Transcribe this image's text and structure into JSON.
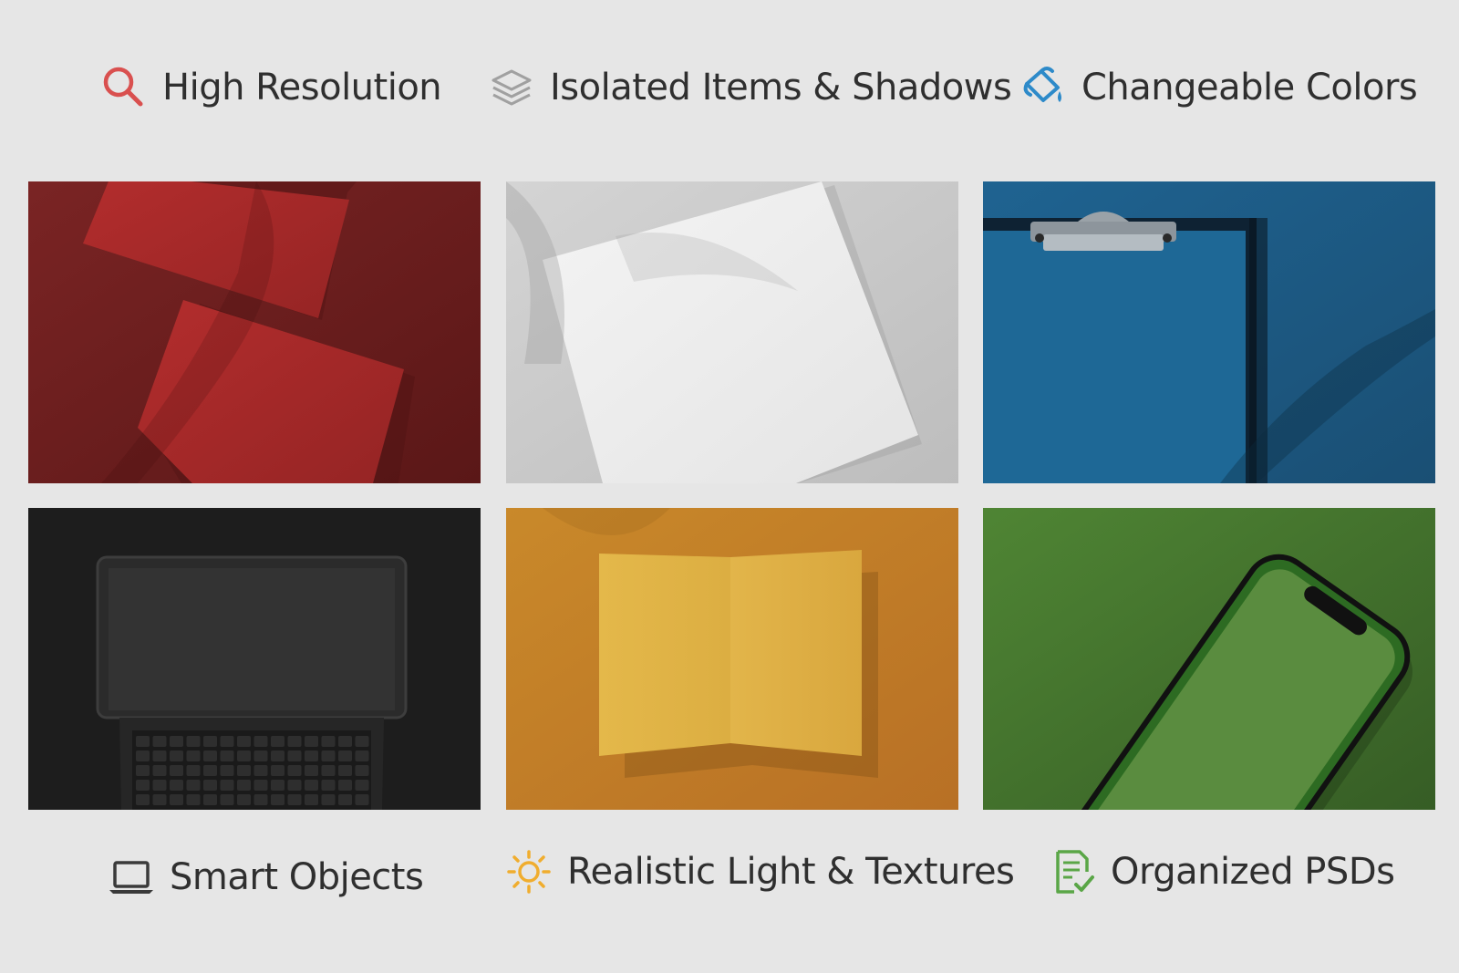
{
  "features_top": [
    {
      "label": "High Resolution",
      "icon": "search-icon",
      "color": "#d9504f"
    },
    {
      "label": "Isolated Items & Shadows",
      "icon": "layers-icon",
      "color": "#9a9a9a"
    },
    {
      "label": "Changeable Colors",
      "icon": "paint-bucket-icon",
      "color": "#2d8ac9"
    }
  ],
  "features_bottom": [
    {
      "label": "Smart Objects",
      "icon": "laptop-icon",
      "color": "#3a3a3a"
    },
    {
      "label": "Realistic Light & Textures",
      "icon": "sun-icon",
      "color": "#f0ad2e"
    },
    {
      "label": "Organized PSDs",
      "icon": "document-check-icon",
      "color": "#5aa647"
    }
  ],
  "tiles": [
    {
      "name": "business-cards-mockup",
      "background": "#7a2424",
      "item_color": "#a82a2a"
    },
    {
      "name": "square-paper-mockup",
      "background": "#cfcfcf",
      "item_color": "#f0f0f0"
    },
    {
      "name": "clipboard-mockup",
      "background": "#1e5b86",
      "item_color": "#1e6896"
    },
    {
      "name": "laptop-mockup",
      "background": "#1d1d1d",
      "item_color": "#2b2b2b"
    },
    {
      "name": "folded-card-mockup",
      "background": "#c88a26",
      "item_color": "#e3b646"
    },
    {
      "name": "smartphone-mockup",
      "background": "#4e8236",
      "item_color": "#5a8c3f"
    }
  ]
}
